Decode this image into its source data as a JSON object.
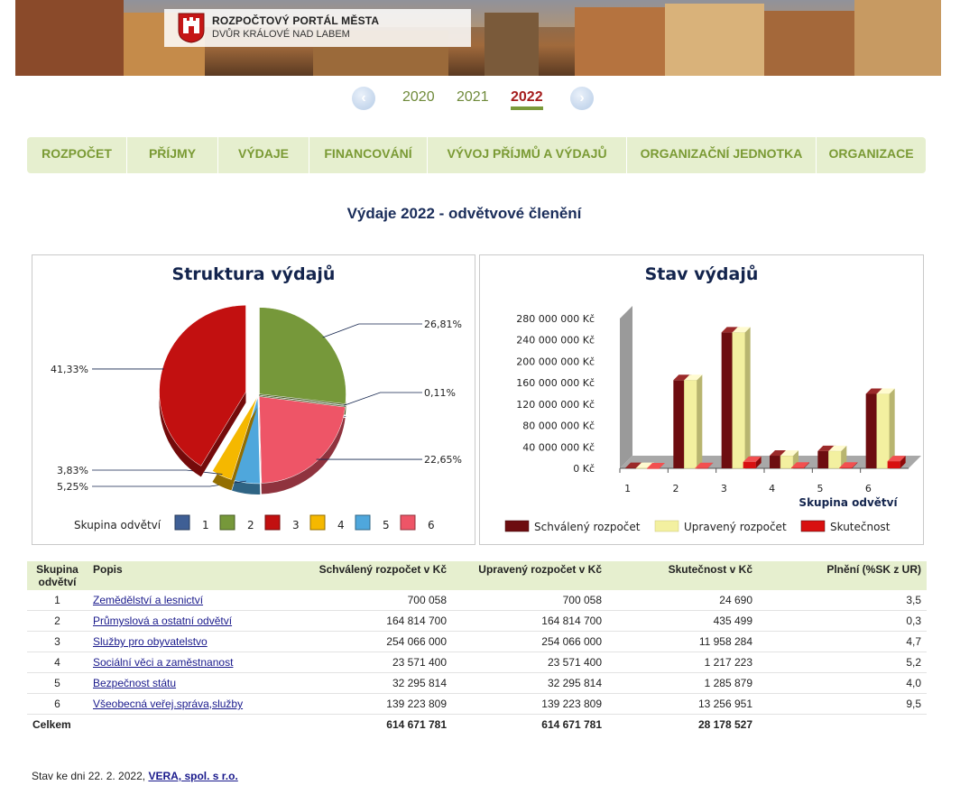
{
  "header": {
    "logo_line1": "ROZPOČTOVÝ PORTÁL MĚSTA",
    "logo_line2": "DVŮR KRÁLOVÉ NAD LABEM"
  },
  "years": {
    "prev_icon": "chevron-left-icon",
    "next_icon": "chevron-right-icon",
    "items": [
      "2020",
      "2021",
      "2022"
    ],
    "active": "2022"
  },
  "nav": {
    "items": [
      "ROZPOČET",
      "PŘÍJMY",
      "VÝDAJE",
      "FINANCOVÁNÍ",
      "VÝVOJ PŘÍJMŮ A VÝDAJŮ",
      "ORGANIZAČNÍ JEDNOTKA",
      "ORGANIZACE"
    ]
  },
  "page_title": "Výdaje 2022  - odvětvové členění",
  "chart_data": [
    {
      "type": "pie",
      "title": "Struktura  výdajů",
      "legend_title": "Skupina odvětví",
      "categories": [
        "1",
        "2",
        "3",
        "4",
        "5",
        "6"
      ],
      "values": [
        0.11,
        26.81,
        41.33,
        3.83,
        5.25,
        22.65
      ],
      "labels": [
        "0,11%",
        "26,81%",
        "41,33%",
        "3,83%",
        "5,25%",
        "22,65%"
      ],
      "colors": [
        "#3f5f95",
        "#76983a",
        "#c21010",
        "#f5b800",
        "#4fa7dc",
        "#ee5567"
      ],
      "legend_position": "bottom"
    },
    {
      "type": "bar",
      "title": "Stav výdajů",
      "xlabel": "Skupina odvětví",
      "ylabel": "",
      "categories": [
        "1",
        "2",
        "3",
        "4",
        "5",
        "6"
      ],
      "y_ticks": [
        "0 Kč",
        "40 000 000 Kč",
        "80 000 000 Kč",
        "120 000 000 Kč",
        "160 000 000 Kč",
        "200 000 000 Kč",
        "240 000 000 Kč",
        "280 000 000 Kč"
      ],
      "ylim": [
        0,
        280000000
      ],
      "series": [
        {
          "name": "Schválený rozpočet",
          "color": "#6d0d10",
          "values": [
            700058,
            164814700,
            254066000,
            23571400,
            32295814,
            139223809
          ]
        },
        {
          "name": "Upravený rozpočet",
          "color": "#f3f0a0",
          "values": [
            700058,
            164814700,
            254066000,
            23571400,
            32295814,
            139223809
          ]
        },
        {
          "name": "Skutečnost",
          "color": "#d81010",
          "values": [
            24690,
            435499,
            11958284,
            1217223,
            1285879,
            13256951
          ]
        }
      ],
      "legend_position": "bottom",
      "grid": false
    }
  ],
  "table": {
    "headers": {
      "group": "Skupina odvětví",
      "desc": "Popis",
      "approved": "Schválený rozpočet v Kč",
      "adjusted": "Upravený rozpočet v Kč",
      "actual": "Skutečnost v Kč",
      "fulfil": "Plnění (%SK z UR)"
    },
    "rows": [
      {
        "group": "1",
        "desc": "Zemědělství a lesnictví",
        "approved": "700 058",
        "adjusted": "700 058",
        "actual": "24 690",
        "fulfil": "3,5"
      },
      {
        "group": "2",
        "desc": "Průmyslová a ostatní odvětví",
        "approved": "164 814 700",
        "adjusted": "164 814 700",
        "actual": "435 499",
        "fulfil": "0,3"
      },
      {
        "group": "3",
        "desc": "Služby pro obyvatelstvo",
        "approved": "254 066 000",
        "adjusted": "254 066 000",
        "actual": "11 958 284",
        "fulfil": "4,7"
      },
      {
        "group": "4",
        "desc": "Sociální věci a zaměstnanost",
        "approved": "23 571 400",
        "adjusted": "23 571 400",
        "actual": "1 217 223",
        "fulfil": "5,2"
      },
      {
        "group": "5",
        "desc": "Bezpečnost státu",
        "approved": "32 295 814",
        "adjusted": "32 295 814",
        "actual": "1 285 879",
        "fulfil": "4,0"
      },
      {
        "group": "6",
        "desc": "Všeobecná veřej.správa,služby",
        "approved": "139 223 809",
        "adjusted": "139 223 809",
        "actual": "13 256 951",
        "fulfil": "9,5"
      }
    ],
    "total": {
      "label": "Celkem",
      "approved": "614 671 781",
      "adjusted": "614 671 781",
      "actual": "28 178 527"
    }
  },
  "footer": {
    "text": "Stav  ke dni  22. 2. 2022,",
    "link": "VERA, spol. s r.o."
  }
}
